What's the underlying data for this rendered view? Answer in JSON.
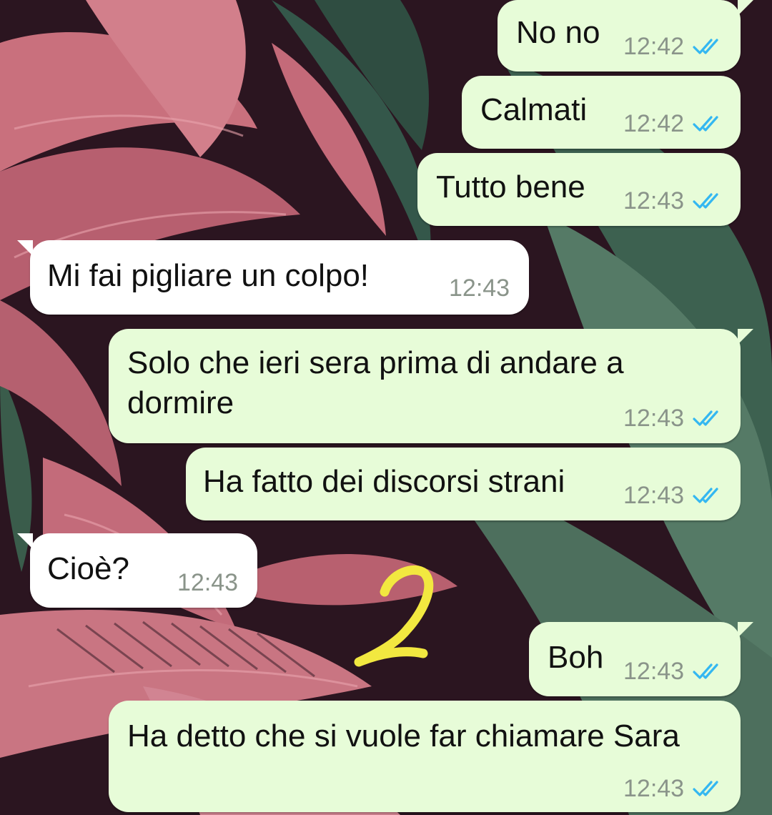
{
  "colors": {
    "outgoing_bubble": "#e7fcd8",
    "incoming_bubble": "#ffffff",
    "read_ticks": "#34b7f1",
    "timestamp": "#8a948a",
    "annotation": "#f2e840"
  },
  "messages": [
    {
      "direction": "outgoing",
      "text": "No no",
      "time": "12:42",
      "status": "read-ticks-icon"
    },
    {
      "direction": "outgoing",
      "text": "Calmati",
      "time": "12:42",
      "status": "read-ticks-icon"
    },
    {
      "direction": "outgoing",
      "text": "Tutto bene",
      "time": "12:43",
      "status": "read-ticks-icon"
    },
    {
      "direction": "incoming",
      "text": "Mi fai pigliare un colpo!",
      "time": "12:43"
    },
    {
      "direction": "outgoing",
      "text_line1": "Solo che ieri sera prima di andare a",
      "text_line2": "dormire",
      "time": "12:43",
      "status": "read-ticks-icon"
    },
    {
      "direction": "outgoing",
      "text": "Ha fatto dei discorsi strani",
      "time": "12:43",
      "status": "read-ticks-icon"
    },
    {
      "direction": "incoming",
      "text": "Cioè?",
      "time": "12:43"
    },
    {
      "direction": "outgoing",
      "text": "Boh",
      "time": "12:43",
      "status": "read-ticks-icon"
    },
    {
      "direction": "outgoing",
      "text": "Ha detto che si vuole far chiamare Sara",
      "time": "12:43",
      "status": "read-ticks-icon"
    }
  ],
  "annotation": {
    "text": "2",
    "icon": "handwritten-number-2"
  }
}
